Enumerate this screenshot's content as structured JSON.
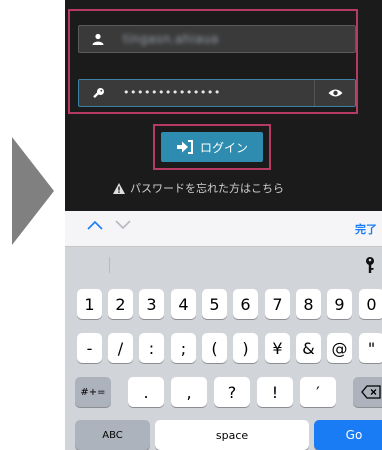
{
  "login": {
    "username_value": "tingasn.ahiaua",
    "password_value": "••••••••••••••",
    "button_label": "ログイン",
    "forgot_text": "パスワードを忘れた方はこちら"
  },
  "keyboard": {
    "done_label": "完了",
    "row1": [
      "1",
      "2",
      "3",
      "4",
      "5",
      "6",
      "7",
      "8",
      "9",
      "0"
    ],
    "row2": [
      "-",
      "/",
      ":",
      ";",
      "(",
      ")",
      "¥",
      "&",
      "@",
      "\""
    ],
    "row3_mode": "#+=",
    "row3": [
      ".",
      ",",
      "?",
      "!",
      "′"
    ],
    "abc_label": "ABC",
    "space_label": "space",
    "go_label": "Go"
  },
  "colors": {
    "highlight": "#b63b63",
    "button": "#2d8cb0",
    "go_key": "#1a7cf5"
  }
}
